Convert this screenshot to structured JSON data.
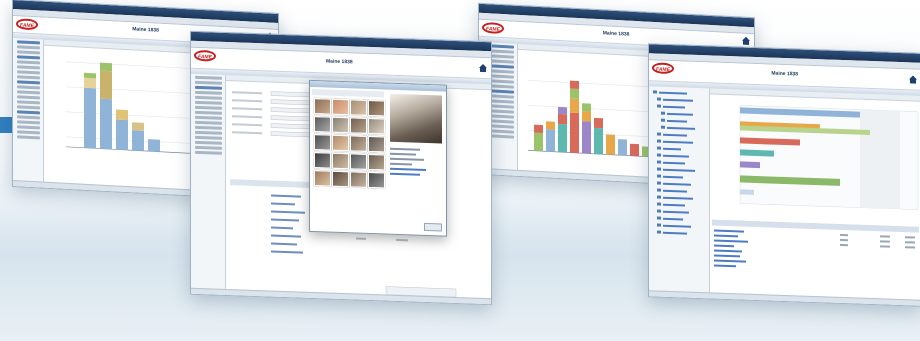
{
  "logo": {
    "text": "FAME",
    "color": "#c81e1e"
  },
  "accent_color": "#2f7fc1",
  "windows": [
    {
      "id": "w1",
      "app_title": "Maine 1838"
    },
    {
      "id": "w2",
      "app_title": "Maine 1838"
    },
    {
      "id": "w3",
      "app_title": "Maine 1838"
    },
    {
      "id": "w4",
      "app_title": "Maine 1838"
    }
  ],
  "icons": [
    "house-icon",
    "folder-icon"
  ],
  "colors": {
    "titlebar": "#1c3557",
    "bar_blue": "#8fb4d8",
    "bar_green": "#9bc46a",
    "bar_orange": "#e8a84a",
    "bar_red": "#d86a5a",
    "bar_teal": "#5fb8b0",
    "bar_purple": "#9a86c8"
  }
}
